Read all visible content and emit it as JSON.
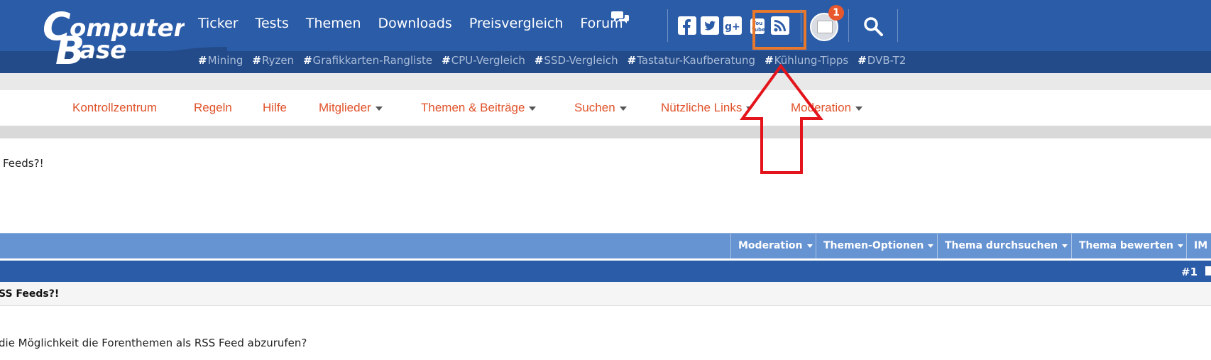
{
  "header": {
    "logo_text": [
      "Computer",
      "Base"
    ],
    "nav": [
      "Ticker",
      "Tests",
      "Themen",
      "Downloads",
      "Preisvergleich",
      "Forum"
    ],
    "tags": [
      "Mining",
      "Ryzen",
      "Grafikkarten-Rangliste",
      "CPU-Vergleich",
      "SSD-Vergleich",
      "Tastatur-Kaufberatung",
      "Kühlung-Tipps",
      "DVB-T2"
    ],
    "tag_prefix": "#",
    "notification_count": "1",
    "social_icons": [
      "facebook-icon",
      "twitter-icon",
      "google-plus-icon",
      "youtube-icon",
      "rss-icon"
    ]
  },
  "nav2": {
    "items": [
      {
        "label": "Kontrollzentrum",
        "dropdown": false
      },
      {
        "label": "Regeln",
        "dropdown": false
      },
      {
        "label": "Hilfe",
        "dropdown": false
      },
      {
        "label": "Mitglieder",
        "dropdown": true
      },
      {
        "label": "Themen & Beiträge",
        "dropdown": true
      },
      {
        "label": "Suchen",
        "dropdown": true
      },
      {
        "label": "Nützliche Links",
        "dropdown": true
      },
      {
        "label": "Moderation",
        "dropdown": true
      }
    ]
  },
  "thread": {
    "title_fragment": "Feeds?!",
    "toolbar": [
      "Moderation",
      "Themen-Optionen",
      "Thema durchsuchen",
      "Thema bewerten",
      "IM"
    ],
    "post_number": "#1",
    "post_title": "SS Feeds?!",
    "post_body": "die Möglichkeit die Forenthemen als RSS Feed abzurufen?"
  },
  "colors": {
    "header_blue": "#2b5ca8",
    "nav_orange": "#e0522a",
    "highlight_box": "#e8782c",
    "annotation_arrow": "#e3141b",
    "toolbar_blue": "#6693d1"
  }
}
